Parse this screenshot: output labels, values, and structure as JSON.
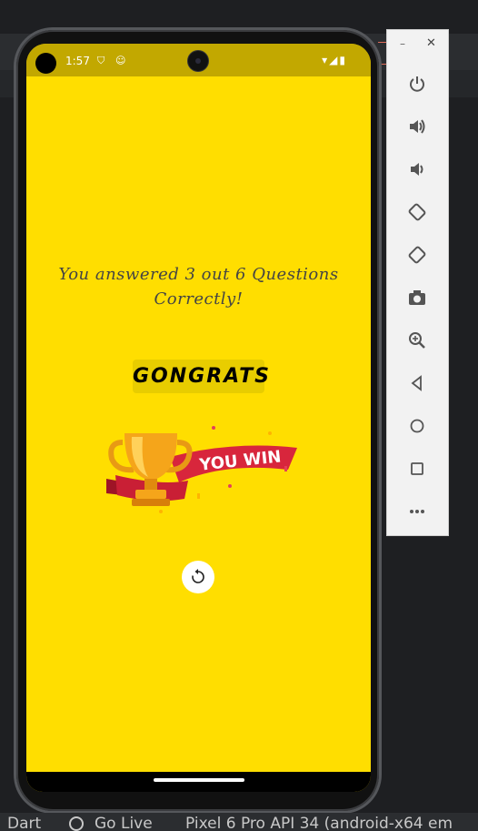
{
  "ide": {
    "status": {
      "dart": "Dart",
      "golive": "Go Live",
      "device": "Pixel 6 Pro API 34 (android-x64 em"
    }
  },
  "phone": {
    "statusbar": {
      "time": "1:57"
    },
    "result_text": "You answered 3  out  6 Questions Correctly!",
    "congrats": "GONGRATS",
    "trophy_text": "YOU WIN",
    "colors": {
      "background": "#ffde00",
      "statusbar": "#c2a800"
    }
  },
  "toolbar": {
    "buttons": [
      "power-icon",
      "volume-up-icon",
      "volume-down-icon",
      "rotate-left-icon",
      "rotate-right-icon",
      "camera-icon",
      "zoom-icon",
      "back-icon",
      "home-icon",
      "overview-icon",
      "more-icon"
    ]
  }
}
